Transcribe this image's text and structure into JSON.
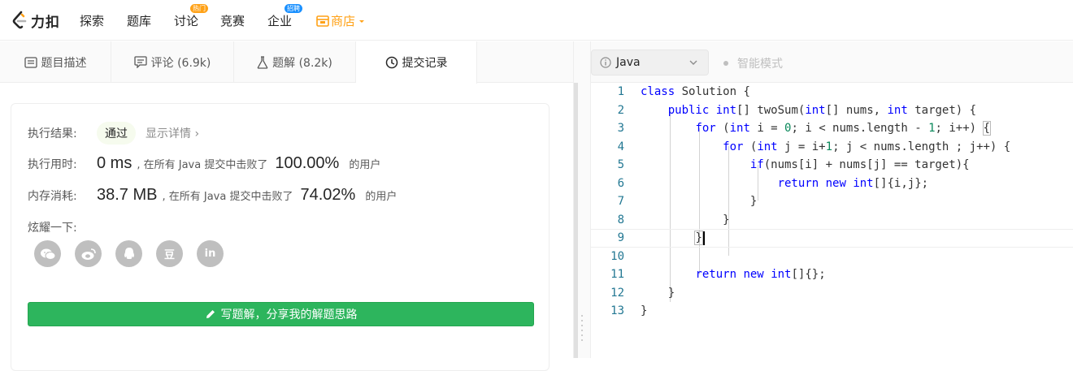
{
  "nav": {
    "logo_text": "力扣",
    "items": [
      {
        "label": "探索"
      },
      {
        "label": "题库"
      },
      {
        "label": "讨论",
        "badge": "热门"
      },
      {
        "label": "竞赛"
      },
      {
        "label": "企业",
        "badge": "招聘"
      },
      {
        "label": "商店"
      }
    ]
  },
  "tabs": [
    {
      "label": "题目描述"
    },
    {
      "label": "评论 (6.9k)"
    },
    {
      "label": "题解 (8.2k)"
    },
    {
      "label": "提交记录",
      "active": true
    }
  ],
  "result": {
    "status_label": "执行结果:",
    "status_value": "通过",
    "details_link": "显示详情 ›",
    "runtime_label": "执行用时:",
    "runtime_value": "0 ms",
    "runtime_text": ", 在所有 Java 提交中击败了",
    "runtime_percent": "100.00%",
    "runtime_suffix": "的用户",
    "memory_label": "内存消耗:",
    "memory_value": "38.7 MB",
    "memory_text": ", 在所有 Java 提交中击败了",
    "memory_percent": "74.02%",
    "memory_suffix": "的用户",
    "share_label": "炫耀一下:",
    "social": [
      "wechat-icon",
      "weibo-icon",
      "qq-icon",
      "douban-icon",
      "linkedin-icon"
    ],
    "douban_glyph": "豆",
    "linkedin_glyph": "in",
    "write_button": "写题解，分享我的解题思路"
  },
  "editor": {
    "language": "Java",
    "smart_mode": "智能模式",
    "lines": [
      {
        "n": "1",
        "html": "<span class=\"kw\">class</span> Solution {"
      },
      {
        "n": "2",
        "html": "    <span class=\"kw\">public</span> <span class=\"kw\">int</span>[] twoSum(<span class=\"kw\">int</span>[] nums, <span class=\"kw\">int</span> target) {"
      },
      {
        "n": "3",
        "html": "        <span class=\"kw\">for</span> (<span class=\"kw\">int</span> i = <span class=\"num\">0</span>; i &lt; nums.length - <span class=\"num\">1</span>; i++) <span class=\"bracket-hl\">{</span>"
      },
      {
        "n": "4",
        "html": "            <span class=\"kw\">for</span> (<span class=\"kw\">int</span> j = i+<span class=\"num\">1</span>; j &lt; nums.length ; j++) {"
      },
      {
        "n": "5",
        "html": "                <span class=\"kw\">if</span>(nums[i] + nums[j] == target){"
      },
      {
        "n": "6",
        "html": "                    <span class=\"kw\">return</span> <span class=\"kw\">new</span> <span class=\"kw\">int</span>[]{i,j};"
      },
      {
        "n": "7",
        "html": "                }"
      },
      {
        "n": "8",
        "html": "            }"
      },
      {
        "n": "9",
        "html": "        <span class=\"bracket-hl\">}</span><span class=\"caret\"></span>"
      },
      {
        "n": "10",
        "html": ""
      },
      {
        "n": "11",
        "html": "        <span class=\"kw\">return</span> <span class=\"kw\">new</span> <span class=\"kw\">int</span>[]{};"
      },
      {
        "n": "12",
        "html": "    }"
      },
      {
        "n": "13",
        "html": "}"
      }
    ]
  }
}
